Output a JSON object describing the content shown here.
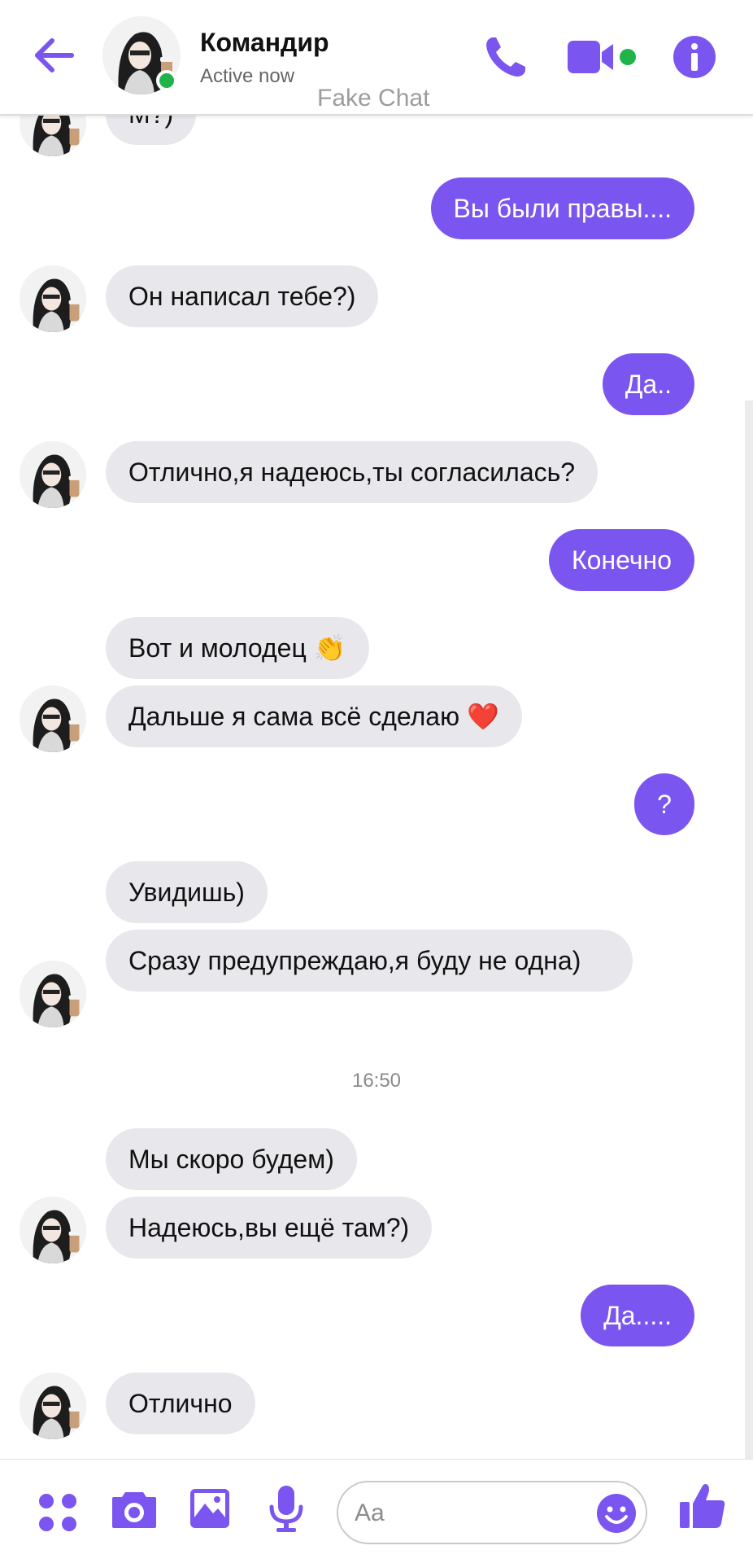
{
  "colors": {
    "accent": "#7b55ef",
    "incoming_bubble": "#e8e7ec",
    "online": "#1fb34a"
  },
  "header": {
    "contact_name": "Командир",
    "status": "Active now",
    "watermark": "Fake Chat",
    "icons": [
      "back-arrow-icon",
      "phone-icon",
      "video-camera-icon",
      "info-icon"
    ]
  },
  "messages": [
    {
      "dir": "in",
      "text": "М?)"
    },
    {
      "dir": "out",
      "text": "Вы были правы...."
    },
    {
      "dir": "in",
      "text": "Он написал тебе?)"
    },
    {
      "dir": "out",
      "text": "Да.."
    },
    {
      "dir": "in",
      "text": "Отлично,я надеюсь,ты согласилась?"
    },
    {
      "dir": "out",
      "text": "Конечно"
    },
    {
      "dir": "in",
      "text": "Вот и молодец 👏"
    },
    {
      "dir": "in",
      "text": "Дальше я сама всё сделаю ❤️"
    },
    {
      "dir": "out",
      "text": "?"
    },
    {
      "dir": "in",
      "text": "Увидишь)"
    },
    {
      "dir": "in",
      "text": "Сразу предупреждаю,я буду не одна)"
    },
    {
      "dir": "in",
      "text": "Мы скоро будем)"
    },
    {
      "dir": "in",
      "text": "Надеюсь,вы ещё там?)"
    },
    {
      "dir": "out",
      "text": "Да....."
    },
    {
      "dir": "in",
      "text": "Отлично"
    }
  ],
  "timestamp": "16:50",
  "composer": {
    "placeholder": "Aa",
    "icons": [
      "apps-grid-icon",
      "camera-icon",
      "image-icon",
      "microphone-icon",
      "emoji-icon",
      "thumbs-up-icon"
    ]
  }
}
